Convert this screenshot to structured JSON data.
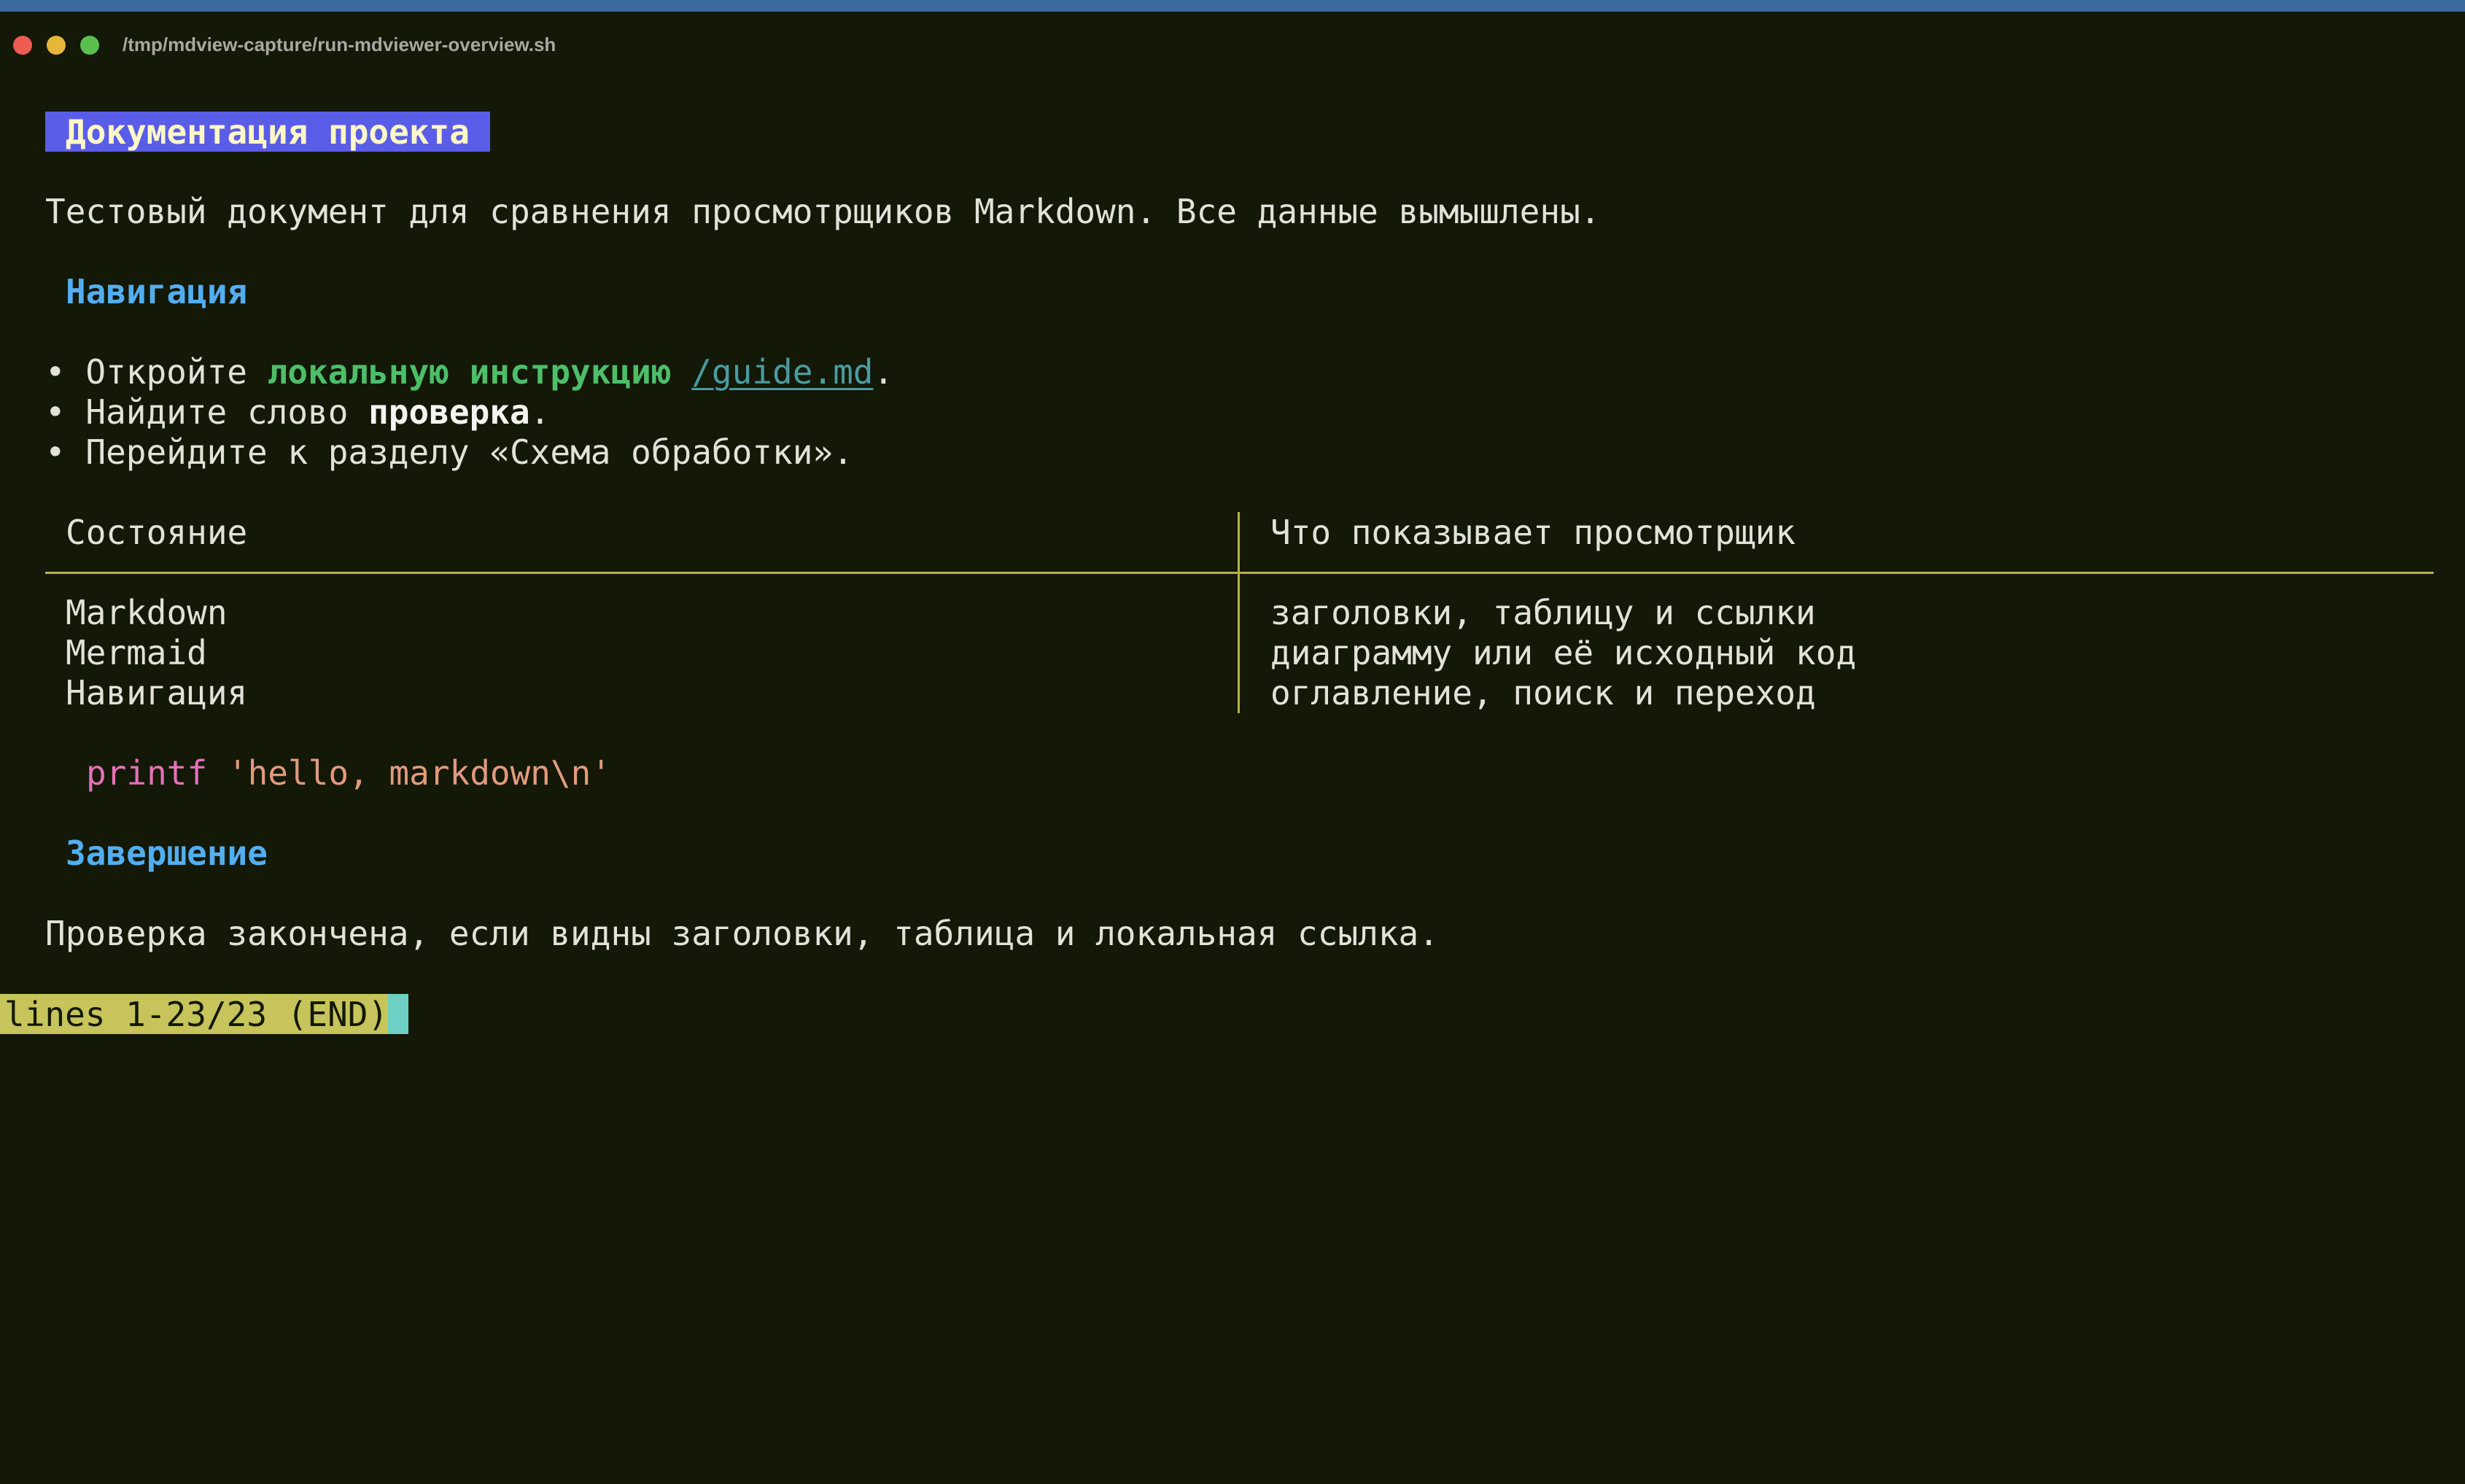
{
  "window": {
    "title": "/tmp/mdview-capture/run-mdviewer-overview.sh"
  },
  "document": {
    "h1": "Документация проекта",
    "intro": "Тестовый документ для сравнения просмотрщиков Markdown. Все данные вымышлены.",
    "section_nav": "Навигация",
    "bullets": {
      "b1_prefix": "• Откройте ",
      "b1_emph": "локальную инструкцию",
      "b1_link": "/guide.md",
      "b1_suffix": ".",
      "b2_prefix": "• Найдите слово ",
      "b2_bold": "проверка",
      "b2_suffix": ".",
      "b3": "• Перейдите к разделу «Схема обработки»."
    },
    "table": {
      "headers": [
        "Состояние",
        "Что показывает просмотрщик"
      ],
      "rows": [
        [
          "Markdown",
          "заголовки, таблицу и ссылки"
        ],
        [
          "Mermaid",
          "диаграмму или её исходный код"
        ],
        [
          "Навигация",
          "оглавление, поиск и переход"
        ]
      ]
    },
    "code": {
      "keyword": "printf",
      "string": "'hello, markdown\\n'"
    },
    "section_end": "Завершение",
    "outro": "Проверка закончена, если видны заголовки, таблица и локальная ссылка."
  },
  "status_line": "lines 1-23/23 (END)",
  "colors": {
    "background": "#131807",
    "h1_background": "#5a5de8",
    "heading": "#53aef0",
    "emphasis": "#4cbf68",
    "link": "#4a9ca0",
    "table_rule": "#b8b24a",
    "status_background": "#c6c45a",
    "cursor": "#6ed0c4"
  }
}
